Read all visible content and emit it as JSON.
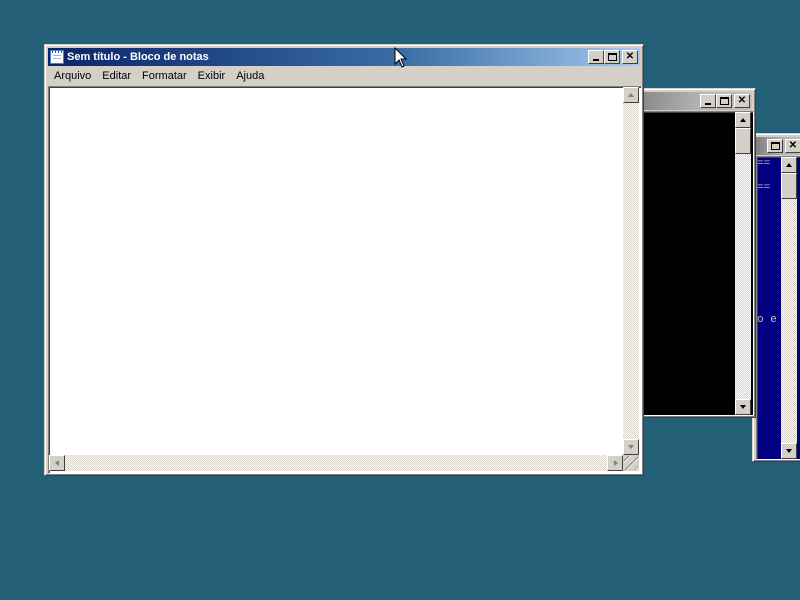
{
  "desktop": {
    "background": "#236077"
  },
  "notepad": {
    "title": "Sem título - Bloco de notas",
    "app_icon": "notepad-icon",
    "menu": [
      "Arquivo",
      "Editar",
      "Formatar",
      "Exibir",
      "Ajuda"
    ],
    "content": "",
    "title_buttons": [
      "minimize-icon",
      "maximize-icon",
      "close-icon"
    ]
  },
  "console_window": {
    "background": "#000000",
    "title_buttons": [
      "minimize-icon",
      "maximize-icon",
      "close-icon"
    ]
  },
  "blue_window": {
    "background": "#000080",
    "text_lines": [
      "==",
      "==",
      "o e"
    ],
    "title_buttons": [
      "maximize-icon",
      "close-icon"
    ]
  },
  "colors": {
    "active_title": "#0a246a",
    "inactive_title": "#808080",
    "face": "#d4d0c8"
  }
}
